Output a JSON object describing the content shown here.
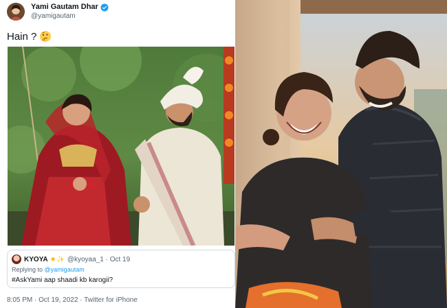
{
  "tweet": {
    "author": {
      "display_name": "Yami Gautam Dhar",
      "handle": "@yamigautam",
      "avatar": "avatar-photo",
      "verified_icon": "verified-badge-icon"
    },
    "text": "Hain ?",
    "emoji": "thinking-face-icon",
    "photo": "wedding-photo",
    "quoted": {
      "name": "KYOYA",
      "badges": [
        "star-icon",
        "emoji-icon"
      ],
      "handle": "@kyoyaa_1",
      "separator": "·",
      "date": "Oct 19",
      "replying_to_prefix": "Replying to",
      "replying_to_handle": "@yamigautam",
      "text": "#AskYami aap shaadi kb karogii?"
    },
    "meta": "8:05 PM · Oct 19, 2022 · Twitter for iPhone"
  },
  "right_photo": "couple-laughing-photo",
  "colors": {
    "text": "#0f1419",
    "muted": "#536471",
    "link": "#1d9bf0",
    "border": "#cfd9de"
  }
}
